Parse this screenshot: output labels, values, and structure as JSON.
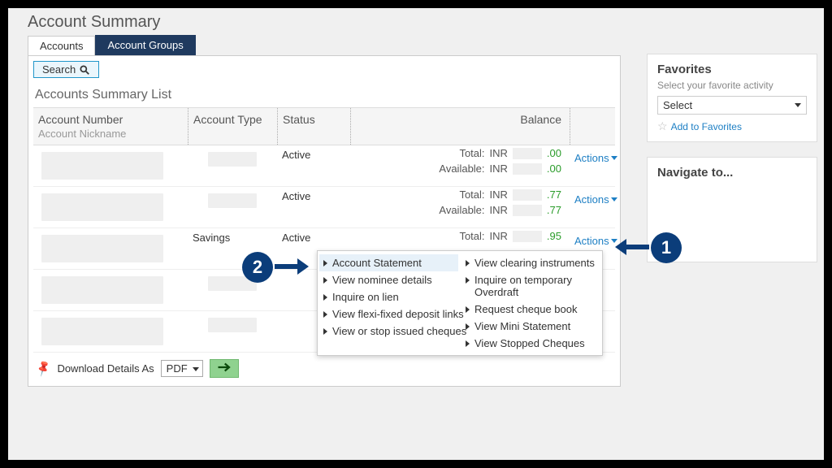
{
  "page": {
    "title": "Account Summary"
  },
  "tabs": {
    "accounts": "Accounts",
    "groups": "Account Groups"
  },
  "search_label": "Search",
  "list_heading": "Accounts Summary List",
  "columns": {
    "account_number": "Account Number",
    "account_nickname": "Account Nickname",
    "account_type": "Account Type",
    "status": "Status",
    "balance": "Balance"
  },
  "rows": [
    {
      "type": "",
      "status": "Active",
      "total_label": "Total:",
      "total_curr": "INR",
      "total_suffix": ".00",
      "avail_label": "Available:",
      "avail_curr": "INR",
      "avail_suffix": ".00",
      "actions": "Actions"
    },
    {
      "type": "",
      "status": "Active",
      "total_label": "Total:",
      "total_curr": "INR",
      "total_suffix": ".77",
      "avail_label": "Available:",
      "avail_curr": "INR",
      "avail_suffix": ".77",
      "actions": "Actions"
    },
    {
      "type": "Savings",
      "status": "Active",
      "total_label": "Total:",
      "total_curr": "INR",
      "total_suffix": ".95",
      "avail_label": "",
      "avail_curr": "",
      "avail_suffix": "",
      "actions": "Actions"
    },
    {
      "type": "",
      "status": "",
      "total_label": "",
      "total_curr": "",
      "total_suffix": "",
      "avail_label": "",
      "avail_curr": "",
      "avail_suffix": "",
      "actions": ""
    },
    {
      "type": "",
      "status": "",
      "total_label": "",
      "total_curr": "",
      "total_suffix": "",
      "avail_label": "",
      "avail_curr": "",
      "avail_suffix": "",
      "actions": ""
    }
  ],
  "actions_menu": {
    "col1": [
      "Account Statement",
      "View nominee details",
      "Inquire on lien",
      "View flexi-fixed deposit links",
      "View or stop issued cheques"
    ],
    "col2": [
      "View clearing instruments",
      "Inquire on temporary Overdraft",
      "Request cheque book",
      "View Mini Statement",
      "View Stopped Cheques"
    ]
  },
  "download": {
    "label": "Download Details As",
    "format": "PDF"
  },
  "favorites": {
    "title": "Favorites",
    "subtitle": "Select your favorite activity",
    "select_placeholder": "Select",
    "add_label": "Add to Favorites"
  },
  "navigate": {
    "title": "Navigate to..."
  },
  "callouts": {
    "one": "1",
    "two": "2"
  }
}
